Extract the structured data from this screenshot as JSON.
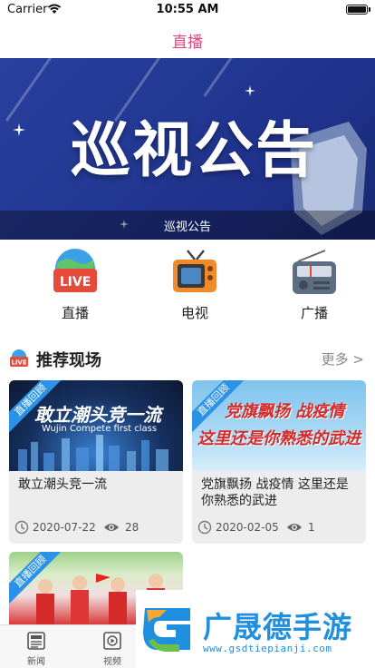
{
  "status_bar": {
    "carrier": "Carrier",
    "time": "10:55 AM"
  },
  "nav": {
    "title": "直播"
  },
  "banner": {
    "headline": "巡视公告",
    "caption": "巡视公告"
  },
  "categories": [
    {
      "label": "直播",
      "icon": "live-icon"
    },
    {
      "label": "电视",
      "icon": "tv-icon"
    },
    {
      "label": "广播",
      "icon": "radio-icon"
    }
  ],
  "section": {
    "title": "推荐现场",
    "more": "更多 >",
    "icon": "live-icon"
  },
  "cards": [
    {
      "badge": "直播回顾",
      "thumb_text": "敢立潮头竞一流",
      "thumb_subtext": "Wujin Compete first class",
      "title": "敢立潮头竞一流",
      "date": "2020-07-22",
      "views": "28"
    },
    {
      "badge": "直播回顾",
      "thumb_text_1": "党旗飘扬 战疫情",
      "thumb_text_2": "这里还是你熟悉的武进",
      "title": "党旗飘扬 战疫情 这里还是你熟悉的武进",
      "date": "2020-02-05",
      "views": "1"
    },
    {
      "badge": "直播回顾"
    }
  ],
  "tabs": [
    {
      "label": "新闻",
      "icon": "news-icon"
    },
    {
      "label": "视频",
      "icon": "video-icon"
    }
  ],
  "watermark": {
    "brand": "广晟德手游",
    "url": "www.gsdtiepianji.com"
  },
  "colors": {
    "accent": "#e8467c",
    "ribbon": "#2b93e7",
    "banner": "#233a95",
    "watermark": "#1f8fe0"
  }
}
